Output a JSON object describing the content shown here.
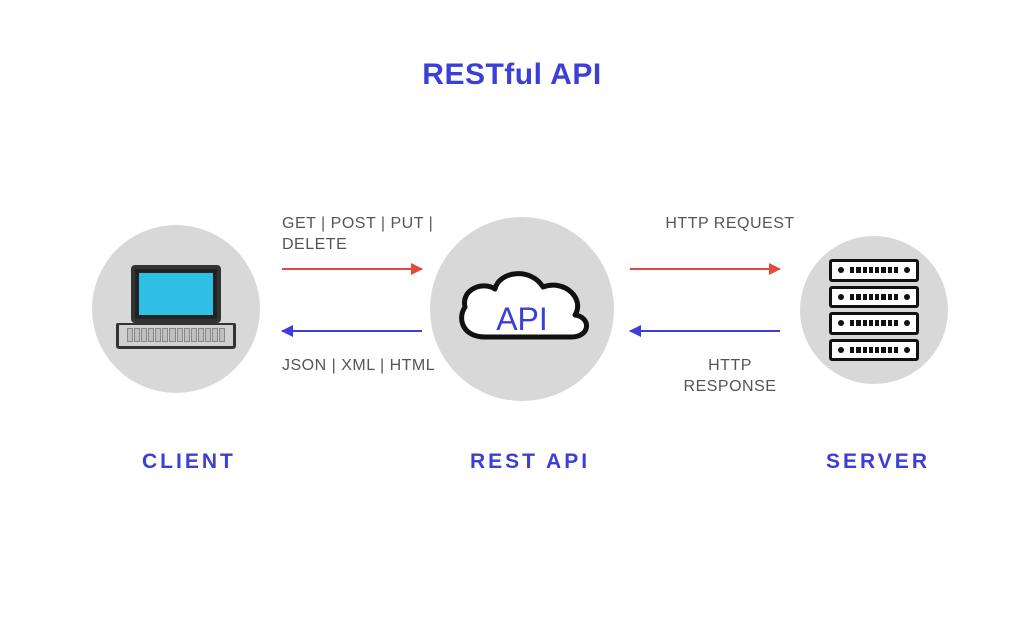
{
  "title": "RESTful API",
  "nodes": {
    "client": {
      "label": "CLIENT",
      "icon": "laptop"
    },
    "api": {
      "label": "REST API",
      "icon": "cloud",
      "cloud_text": "API"
    },
    "server": {
      "label": "SERVER",
      "icon": "server-rack"
    }
  },
  "arrows": {
    "client_to_api": {
      "direction": "right",
      "color": "#e24a3b",
      "label": "GET | POST | PUT | DELETE"
    },
    "api_to_client": {
      "direction": "left",
      "color": "#3b3fd8",
      "label": "JSON | XML | HTML"
    },
    "api_to_server": {
      "direction": "right",
      "color": "#e24a3b",
      "label": "HTTP REQUEST"
    },
    "server_to_api": {
      "direction": "left",
      "color": "#3b3fd8",
      "label": "HTTP RESPONSE"
    }
  },
  "colors": {
    "accent_blue": "#3b3fd8",
    "accent_red": "#e24a3b",
    "neutral_gray": "#d8d8d8",
    "screen_cyan": "#2ec0e4"
  }
}
